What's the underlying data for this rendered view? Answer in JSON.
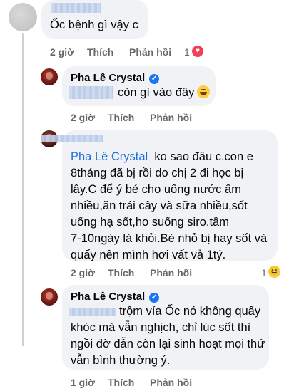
{
  "comments": [
    {
      "text": "Ốc bệnh gì vậy c",
      "time": "2 giờ",
      "like_label": "Thích",
      "reply_label": "Phản hồi",
      "reaction_count": "1",
      "reaction": "heart-icon"
    },
    {
      "author": "Pha Lê Crystal",
      "text": "còn gì vào đây",
      "time": "2 giờ",
      "like_label": "Thích",
      "reply_label": "Phản hồi"
    },
    {
      "mention": "Pha Lê Crystal",
      "text_lines": [
        "ko sao đâu c.con e",
        "8tháng đã bị rồi do chị 2 đi học bị",
        "lây.C để ý bé cho uống nước ấm",
        "nhiều,ăn trái cây và sữa nhiều,sốt",
        "uống hạ sốt,ho suống siro.tầm",
        "7-10ngày là khỏi.Bé nhỏ bị hay sốt và",
        "quấy nên mình hơi vất vả 1tý."
      ],
      "time": "2 giờ",
      "like_label": "Thích",
      "reply_label": "Phản hồi",
      "reaction_count": "1",
      "reaction": "laugh-icon"
    },
    {
      "author": "Pha Lê Crystal",
      "text_lines": [
        "trộm vía Ốc nó không quấy",
        "khóc mà vẫn nghịch, chỉ lúc sốt thì",
        "ngồi đờ đẫn còn lại sinh hoạt mọi thứ",
        "vẫn bình thường ý."
      ],
      "time": "1 giờ",
      "like_label": "Thích",
      "reply_label": "Phản hồi"
    }
  ],
  "colors": {
    "bubble": "#f0f2f5",
    "meta": "#65676b",
    "link": "#216fdb",
    "verified": "#1877f2"
  }
}
